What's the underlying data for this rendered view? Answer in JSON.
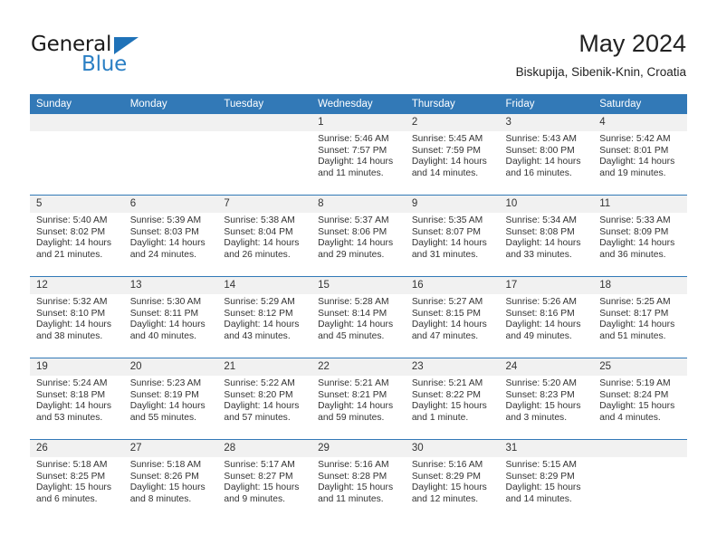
{
  "brand": {
    "name_top": "General",
    "name_bottom": "Blue",
    "accent_color": "#2a7fc4",
    "triangle_color": "#1f72b8"
  },
  "header": {
    "month_title": "May 2024",
    "location": "Biskupija, Sibenik-Knin, Croatia"
  },
  "calendar": {
    "header_bg": "#3279b7",
    "day_bar_bg": "#f1f1f1",
    "weekday_headers": [
      "Sunday",
      "Monday",
      "Tuesday",
      "Wednesday",
      "Thursday",
      "Friday",
      "Saturday"
    ],
    "labels": {
      "sunrise_prefix": "Sunrise:",
      "sunset_prefix": "Sunset:",
      "daylight_prefix": "Daylight:"
    },
    "weeks": [
      [
        {
          "day": "",
          "empty": true
        },
        {
          "day": "",
          "empty": true
        },
        {
          "day": "",
          "empty": true
        },
        {
          "day": "1",
          "sunrise": "Sunrise: 5:46 AM",
          "sunset": "Sunset: 7:57 PM",
          "daylight": "Daylight: 14 hours and 11 minutes."
        },
        {
          "day": "2",
          "sunrise": "Sunrise: 5:45 AM",
          "sunset": "Sunset: 7:59 PM",
          "daylight": "Daylight: 14 hours and 14 minutes."
        },
        {
          "day": "3",
          "sunrise": "Sunrise: 5:43 AM",
          "sunset": "Sunset: 8:00 PM",
          "daylight": "Daylight: 14 hours and 16 minutes."
        },
        {
          "day": "4",
          "sunrise": "Sunrise: 5:42 AM",
          "sunset": "Sunset: 8:01 PM",
          "daylight": "Daylight: 14 hours and 19 minutes."
        }
      ],
      [
        {
          "day": "5",
          "sunrise": "Sunrise: 5:40 AM",
          "sunset": "Sunset: 8:02 PM",
          "daylight": "Daylight: 14 hours and 21 minutes."
        },
        {
          "day": "6",
          "sunrise": "Sunrise: 5:39 AM",
          "sunset": "Sunset: 8:03 PM",
          "daylight": "Daylight: 14 hours and 24 minutes."
        },
        {
          "day": "7",
          "sunrise": "Sunrise: 5:38 AM",
          "sunset": "Sunset: 8:04 PM",
          "daylight": "Daylight: 14 hours and 26 minutes."
        },
        {
          "day": "8",
          "sunrise": "Sunrise: 5:37 AM",
          "sunset": "Sunset: 8:06 PM",
          "daylight": "Daylight: 14 hours and 29 minutes."
        },
        {
          "day": "9",
          "sunrise": "Sunrise: 5:35 AM",
          "sunset": "Sunset: 8:07 PM",
          "daylight": "Daylight: 14 hours and 31 minutes."
        },
        {
          "day": "10",
          "sunrise": "Sunrise: 5:34 AM",
          "sunset": "Sunset: 8:08 PM",
          "daylight": "Daylight: 14 hours and 33 minutes."
        },
        {
          "day": "11",
          "sunrise": "Sunrise: 5:33 AM",
          "sunset": "Sunset: 8:09 PM",
          "daylight": "Daylight: 14 hours and 36 minutes."
        }
      ],
      [
        {
          "day": "12",
          "sunrise": "Sunrise: 5:32 AM",
          "sunset": "Sunset: 8:10 PM",
          "daylight": "Daylight: 14 hours and 38 minutes."
        },
        {
          "day": "13",
          "sunrise": "Sunrise: 5:30 AM",
          "sunset": "Sunset: 8:11 PM",
          "daylight": "Daylight: 14 hours and 40 minutes."
        },
        {
          "day": "14",
          "sunrise": "Sunrise: 5:29 AM",
          "sunset": "Sunset: 8:12 PM",
          "daylight": "Daylight: 14 hours and 43 minutes."
        },
        {
          "day": "15",
          "sunrise": "Sunrise: 5:28 AM",
          "sunset": "Sunset: 8:14 PM",
          "daylight": "Daylight: 14 hours and 45 minutes."
        },
        {
          "day": "16",
          "sunrise": "Sunrise: 5:27 AM",
          "sunset": "Sunset: 8:15 PM",
          "daylight": "Daylight: 14 hours and 47 minutes."
        },
        {
          "day": "17",
          "sunrise": "Sunrise: 5:26 AM",
          "sunset": "Sunset: 8:16 PM",
          "daylight": "Daylight: 14 hours and 49 minutes."
        },
        {
          "day": "18",
          "sunrise": "Sunrise: 5:25 AM",
          "sunset": "Sunset: 8:17 PM",
          "daylight": "Daylight: 14 hours and 51 minutes."
        }
      ],
      [
        {
          "day": "19",
          "sunrise": "Sunrise: 5:24 AM",
          "sunset": "Sunset: 8:18 PM",
          "daylight": "Daylight: 14 hours and 53 minutes."
        },
        {
          "day": "20",
          "sunrise": "Sunrise: 5:23 AM",
          "sunset": "Sunset: 8:19 PM",
          "daylight": "Daylight: 14 hours and 55 minutes."
        },
        {
          "day": "21",
          "sunrise": "Sunrise: 5:22 AM",
          "sunset": "Sunset: 8:20 PM",
          "daylight": "Daylight: 14 hours and 57 minutes."
        },
        {
          "day": "22",
          "sunrise": "Sunrise: 5:21 AM",
          "sunset": "Sunset: 8:21 PM",
          "daylight": "Daylight: 14 hours and 59 minutes."
        },
        {
          "day": "23",
          "sunrise": "Sunrise: 5:21 AM",
          "sunset": "Sunset: 8:22 PM",
          "daylight": "Daylight: 15 hours and 1 minute."
        },
        {
          "day": "24",
          "sunrise": "Sunrise: 5:20 AM",
          "sunset": "Sunset: 8:23 PM",
          "daylight": "Daylight: 15 hours and 3 minutes."
        },
        {
          "day": "25",
          "sunrise": "Sunrise: 5:19 AM",
          "sunset": "Sunset: 8:24 PM",
          "daylight": "Daylight: 15 hours and 4 minutes."
        }
      ],
      [
        {
          "day": "26",
          "sunrise": "Sunrise: 5:18 AM",
          "sunset": "Sunset: 8:25 PM",
          "daylight": "Daylight: 15 hours and 6 minutes."
        },
        {
          "day": "27",
          "sunrise": "Sunrise: 5:18 AM",
          "sunset": "Sunset: 8:26 PM",
          "daylight": "Daylight: 15 hours and 8 minutes."
        },
        {
          "day": "28",
          "sunrise": "Sunrise: 5:17 AM",
          "sunset": "Sunset: 8:27 PM",
          "daylight": "Daylight: 15 hours and 9 minutes."
        },
        {
          "day": "29",
          "sunrise": "Sunrise: 5:16 AM",
          "sunset": "Sunset: 8:28 PM",
          "daylight": "Daylight: 15 hours and 11 minutes."
        },
        {
          "day": "30",
          "sunrise": "Sunrise: 5:16 AM",
          "sunset": "Sunset: 8:29 PM",
          "daylight": "Daylight: 15 hours and 12 minutes."
        },
        {
          "day": "31",
          "sunrise": "Sunrise: 5:15 AM",
          "sunset": "Sunset: 8:29 PM",
          "daylight": "Daylight: 15 hours and 14 minutes."
        },
        {
          "day": "",
          "empty": true
        }
      ]
    ]
  }
}
